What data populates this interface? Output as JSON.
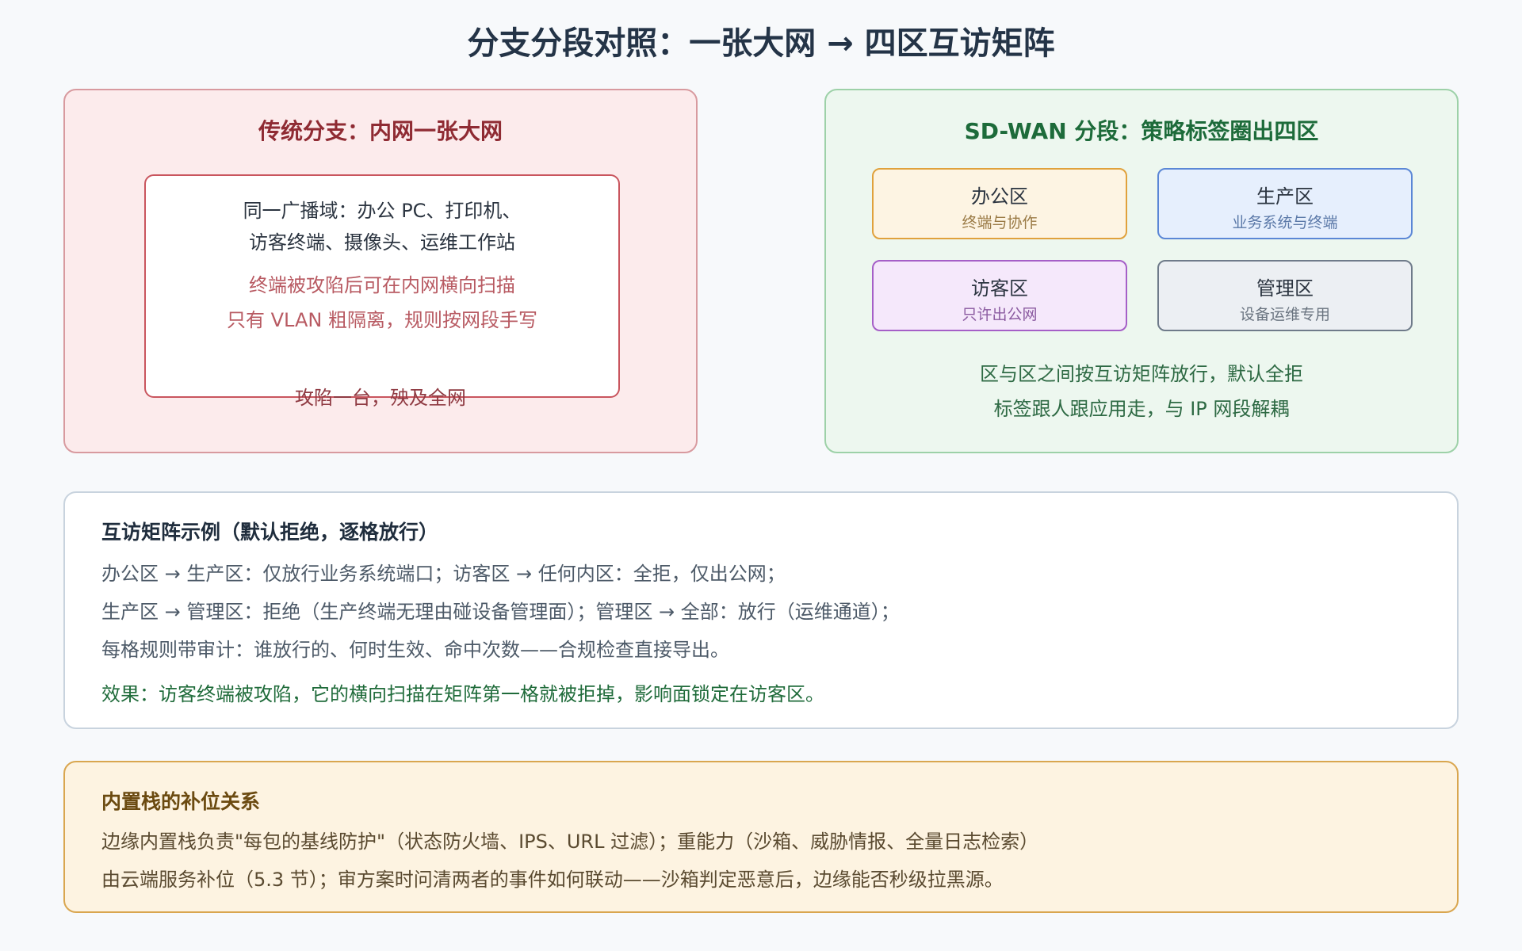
{
  "title": "分支分段对照：一张大网 → 四区互访矩阵",
  "traditional": {
    "title": "传统分支：内网一张大网",
    "lines": [
      "同一广播域：办公 PC、打印机、",
      "访客终端、摄像头、运维工作站",
      "终端被攻陷后可在内网横向扫描",
      "只有 VLAN 粗隔离，规则按网段手写"
    ],
    "footer": "攻陷一台，殃及全网"
  },
  "sdwan": {
    "title": "SD-WAN 分段：策略标签圈出四区",
    "zones": [
      {
        "name": "办公区",
        "desc": "终端与协作"
      },
      {
        "name": "生产区",
        "desc": "业务系统与终端"
      },
      {
        "name": "访客区",
        "desc": "只许出公网"
      },
      {
        "name": "管理区",
        "desc": "设备运维专用"
      }
    ],
    "notes": [
      "区与区之间按互访矩阵放行，默认全拒",
      "标签跟人跟应用走，与 IP 网段解耦"
    ]
  },
  "matrix": {
    "title": "互访矩阵示例（默认拒绝，逐格放行）",
    "lines": [
      "办公区 → 生产区：仅放行业务系统端口；访客区 → 任何内区：全拒，仅出公网；",
      "生产区 → 管理区：拒绝（生产终端无理由碰设备管理面）；管理区 → 全部：放行（运维通道）；",
      "每格规则带审计：谁放行的、何时生效、命中次数——合规检查直接导出。"
    ],
    "effect": "效果：访客终端被攻陷，它的横向扫描在矩阵第一格就被拒掉，影响面锁定在访客区。"
  },
  "stack": {
    "title": "内置栈的补位关系",
    "lines": [
      "边缘内置栈负责\"每包的基线防护\"（状态防火墙、IPS、URL 过滤）；重能力（沙箱、威胁情报、全量日志检索）",
      "由云端服务补位（5.3 节）；审方案时问清两者的事件如何联动——沙箱判定恶意后，边缘能否秒级拉黑源。"
    ]
  }
}
